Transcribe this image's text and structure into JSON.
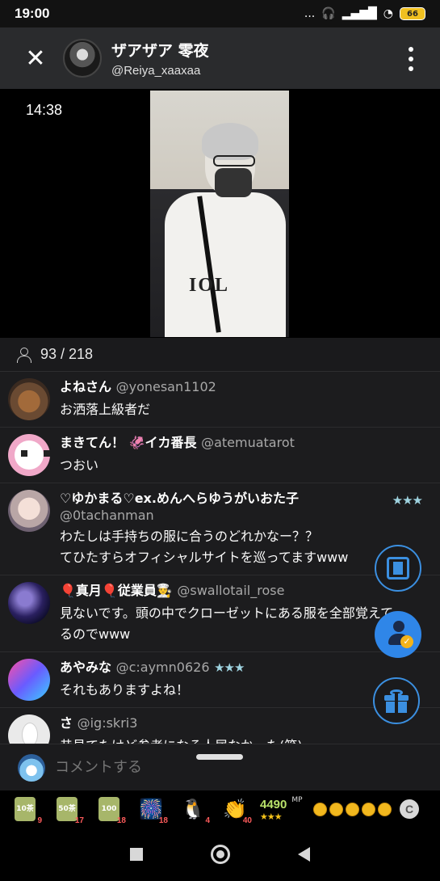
{
  "status_bar": {
    "time": "19:00",
    "dots": "...",
    "icons": [
      "headphones-icon",
      "signal-icon",
      "wifi-icon"
    ],
    "battery": "66"
  },
  "header": {
    "close_icon": "✕",
    "host_name": "ザアザア 零夜",
    "host_handle": "@Reiya_xaaxaa"
  },
  "video": {
    "elapsed": "14:38",
    "shirt_text": "IOL"
  },
  "viewers": {
    "count": "93 / 218"
  },
  "comments": [
    {
      "name": "よねさん",
      "handle": "@yonesan1102",
      "badge": "",
      "text": "お洒落上級者だ"
    },
    {
      "name": "まきてん！ 🦑イカ番長",
      "handle": "@atemuatarot",
      "badge": "",
      "text": "つおい"
    },
    {
      "name": "♡ゆかまる♡ex.めんへらゆうがいおた子",
      "handle": "@0tachanman",
      "badge": "★★★",
      "text": "わたしは手持ちの服に合うのどれかなー？？\nてひたすらオフィシャルサイトを巡ってますwww"
    },
    {
      "name": "🎈真月🎈従業員👨‍🍳",
      "handle": "@swallotail_rose",
      "badge": "",
      "text": "見ないです。頭の中でクローゼットにある服を全部覚えて\nるのでwww"
    },
    {
      "name": "あやみな",
      "handle": "@c:aymn0626",
      "badge": "★★★",
      "text": "それもありますよね！"
    },
    {
      "name": "さ",
      "handle": "@ig:skri3",
      "badge": "",
      "text": "昔見てたけど参考になる人居なかった(笑)"
    }
  ],
  "comment_input": {
    "placeholder": "コメントする"
  },
  "gift_bar": {
    "items": [
      {
        "icon": "tea-10-icon",
        "label": "10\n茶",
        "count": "9"
      },
      {
        "icon": "tea-50-icon",
        "label": "50\n茶",
        "count": "17"
      },
      {
        "icon": "tea-100-icon",
        "label": "100\n茶",
        "count": "18"
      },
      {
        "icon": "fireworks-icon",
        "glyph": "🎆",
        "count": "18"
      },
      {
        "icon": "penguin-icon",
        "glyph": "🐧",
        "count": "4"
      },
      {
        "icon": "clap-icon",
        "glyph": "👏",
        "count": "40"
      }
    ],
    "mp_value": "4490",
    "mp_unit": "MP",
    "mp_stars": "★★★",
    "coins": 5,
    "c_label": "C"
  },
  "colors": {
    "accent": "#3b8fe0",
    "comment_bg": "#1c1c1e",
    "header_bg": "#2a2b2d",
    "badge_stars": "#9fd3e0"
  }
}
